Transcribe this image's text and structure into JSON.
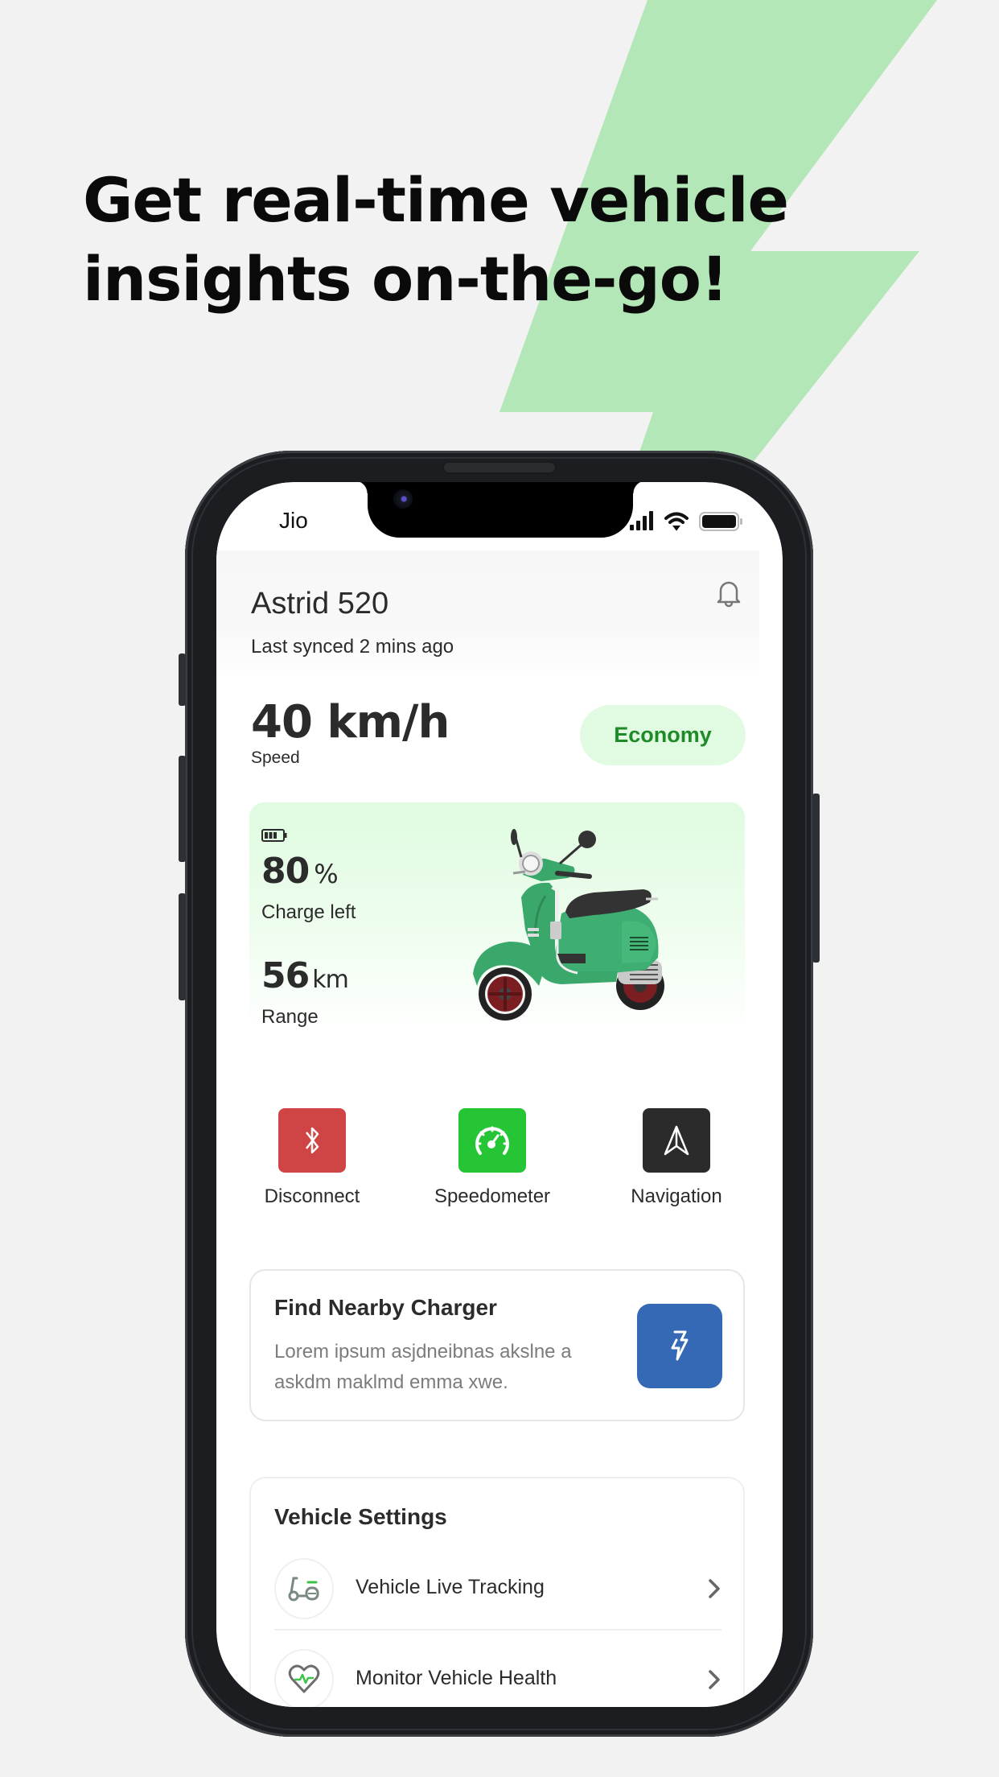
{
  "promo": {
    "headline_line1": "Get real-time vehicle",
    "headline_line2": "insights on-the-go!",
    "accent_color": "#b4e7b7",
    "background_color": "#f2f2f2"
  },
  "status_bar": {
    "carrier": "Jio",
    "icons": [
      "signal-icon",
      "wifi-icon",
      "battery-icon"
    ]
  },
  "header": {
    "vehicle_name": "Astrid 520",
    "last_synced": "Last synced 2 mins ago",
    "notification_icon": "bell-icon"
  },
  "speed": {
    "value": "40 km/h",
    "label": "Speed",
    "mode": "Economy",
    "mode_color": "#1e8b28",
    "mode_bg": "#e1fbe2"
  },
  "charge_card": {
    "charge_value": "80",
    "charge_unit": "%",
    "charge_label": "Charge left",
    "charge_level": 0.8,
    "range_value": "56",
    "range_unit": "km",
    "range_label": "Range",
    "image": "green-scooter"
  },
  "actions": [
    {
      "label": "Disconnect",
      "icon": "bluetooth-icon",
      "color": "#cf4444"
    },
    {
      "label": "Speedometer",
      "icon": "speedometer-icon",
      "color": "#26c536"
    },
    {
      "label": "Navigation",
      "icon": "navigation-arrow-icon",
      "color": "#2b2b2b"
    }
  ],
  "charger_card": {
    "title": "Find Nearby Charger",
    "description": "Lorem ipsum asjdneibnas akslne a askdm maklmd emma xwe.",
    "button_icon": "lightning-icon",
    "button_color": "#3568b5"
  },
  "vehicle_settings": {
    "title": "Vehicle Settings",
    "items": [
      {
        "label": "Vehicle Live Tracking",
        "icon": "scooter-icon"
      },
      {
        "label": "Monitor Vehicle Health",
        "icon": "heart-pulse-icon"
      }
    ]
  }
}
